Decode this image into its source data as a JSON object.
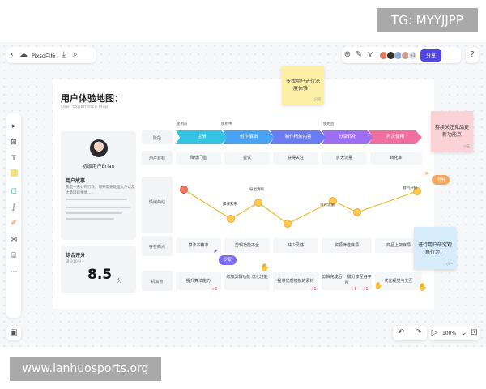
{
  "watermarks": {
    "top": "TG: MYYJJPP",
    "bottom": "www.lanhuosports.org"
  },
  "toolbar": {
    "doc_title": "Pixso白板",
    "share_label": "分享"
  },
  "icons": {
    "back": "chevron-left-icon",
    "cloud": "cloud-icon",
    "export": "export-icon",
    "search": "search-icon",
    "add": "plus-icon",
    "lasso": "lasso-icon",
    "more": "more-icon",
    "help": "help-icon"
  },
  "board": {
    "title": "用户体验地图：",
    "subtitle": "User Experience Map",
    "profile": {
      "name": "初级用户Brian",
      "story_heading": "用户故事",
      "story_lines": [
        "我是一名公司行政，每天需要处理文件以及",
        "大量琐碎事情……"
      ]
    },
    "score": {
      "heading": "综合评分",
      "sub": "满分10分",
      "value": "8.5",
      "unit": "分"
    },
    "row_labels": [
      "阶段",
      "用户目标",
      "情绪曲线",
      "存在痛点",
      "机会点"
    ],
    "stage_tops": [
      "使用前",
      "使用中",
      "使用后"
    ],
    "stages": [
      {
        "label": "注册",
        "color": "#36c3e3"
      },
      {
        "label": "创作编辑",
        "color": "#4aa3f0"
      },
      {
        "label": "制作精美内容",
        "color": "#6b7bf2"
      },
      {
        "label": "分享转化",
        "color": "#9d6ff0"
      },
      {
        "label": "再次使用",
        "color": "#ef6fa0"
      }
    ],
    "goals": [
      "降低门槛",
      "尝试",
      "获得关注",
      "扩大流量",
      "转化率"
    ],
    "emotion_labels": [
      "操作繁杂",
      "导出清晰",
      "没有流量",
      "顺利开播"
    ],
    "pains": [
      "算法不精准",
      "剪辑功能不全",
      "缺少灵感",
      "资源筛选麻烦",
      "商品上架麻烦"
    ],
    "opportunities": [
      "提升算法能力",
      "增加剪辑功能 优化性能",
      "提供优质模板的素材",
      "剪辑完成后 一键分享至各平台",
      "优化视觉与交互"
    ],
    "badges": [
      "+1",
      "+1",
      "+1",
      "+1"
    ]
  },
  "stickies": [
    {
      "text": "多找用户进行深度体验！",
      "color": "#fdf0a6",
      "tag": "贝塔"
    },
    {
      "text": "持续关注竞品更新功能点",
      "color": "#fbd3d6",
      "tag": "小王"
    },
    {
      "text": "进行用户研究观察行为！",
      "color": "#d7ecfb",
      "tag": "小卢"
    }
  ],
  "bubbles": [
    {
      "text": "罗蒙",
      "color": "#7a6df0"
    },
    {
      "text": "阿明",
      "color": "#f2a65a"
    }
  ],
  "zoom": "100%"
}
